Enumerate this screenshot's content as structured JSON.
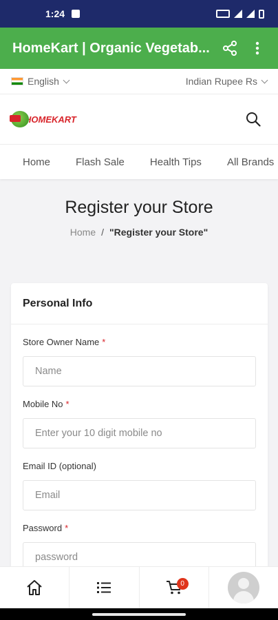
{
  "status_bar": {
    "time": "1:24"
  },
  "app_bar": {
    "title": "HomeKart | Organic Vegetab...",
    "share_icon": "share-icon",
    "menu_icon": "more-vert-icon"
  },
  "top_bar": {
    "language": "English",
    "currency": "Indian Rupee Rs"
  },
  "header": {
    "logo_text": "HOMEKART",
    "search_icon": "search-icon"
  },
  "nav": {
    "items": [
      "Home",
      "Flash Sale",
      "Health Tips",
      "All Brands"
    ]
  },
  "page": {
    "title": "Register your Store",
    "breadcrumb": {
      "home": "Home",
      "separator": "/",
      "current": "\"Register your Store\""
    }
  },
  "form": {
    "section_title": "Personal Info",
    "fields": [
      {
        "label": "Store Owner Name",
        "required": "*",
        "placeholder": "Name",
        "value": ""
      },
      {
        "label": "Mobile No",
        "required": "*",
        "placeholder": "Enter your 10 digit mobile no",
        "value": ""
      },
      {
        "label": "Email ID (optional)",
        "required": "",
        "placeholder": "Email",
        "value": ""
      },
      {
        "label": "Password",
        "required": "*",
        "placeholder": "password",
        "value": ""
      }
    ]
  },
  "bottom_nav": {
    "cart_count": "0"
  },
  "colors": {
    "brand_green": "#4cae4c",
    "status_bar": "#1e2a6a",
    "required_red": "#d8242a",
    "badge": "#e0341b"
  }
}
